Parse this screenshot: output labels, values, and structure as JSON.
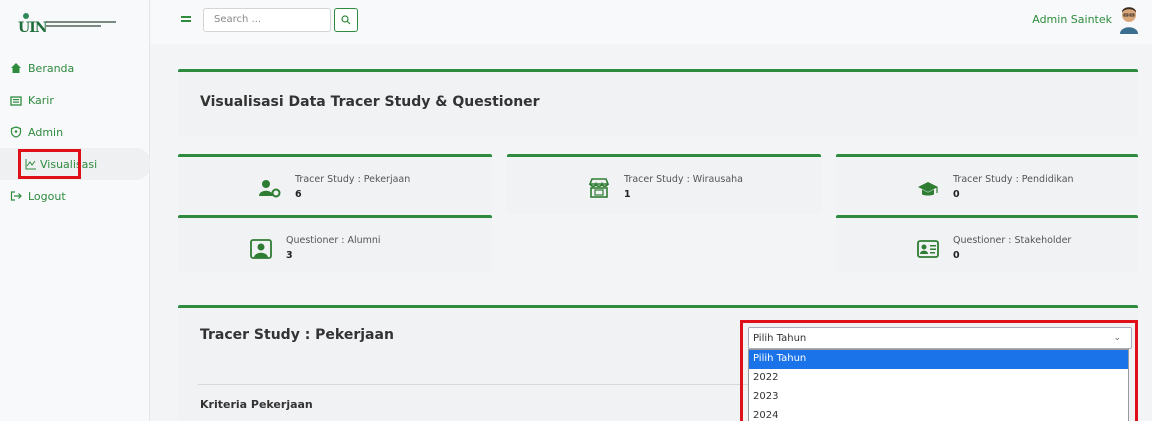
{
  "sidebar": {
    "items": [
      {
        "label": "Beranda",
        "icon": "home-icon"
      },
      {
        "label": "Karir",
        "icon": "briefcase-icon"
      },
      {
        "label": "Admin",
        "icon": "shield-icon"
      },
      {
        "label": "Visualisasi",
        "icon": "chart-icon",
        "active": true
      },
      {
        "label": "Logout",
        "icon": "logout-icon"
      }
    ]
  },
  "topbar": {
    "search_placeholder": "Search ...",
    "user_name": "Admin Saintek"
  },
  "main": {
    "page_title": "Visualisasi Data Tracer Study & Questioner",
    "stats": [
      {
        "label": "Tracer Study : Pekerjaan",
        "value": "6",
        "icon": "user-gear-icon"
      },
      {
        "label": "Tracer Study : Wirausaha",
        "value": "1",
        "icon": "store-icon"
      },
      {
        "label": "Tracer Study : Pendidikan",
        "value": "0",
        "icon": "graduation-cap-icon"
      },
      {
        "label": "Questioner : Alumni",
        "value": "3",
        "icon": "user-board-icon"
      },
      {
        "label": "Questioner : Stakeholder",
        "value": "0",
        "icon": "id-card-icon"
      }
    ],
    "section": {
      "title": "Tracer Study : Pekerjaan",
      "subheading": "Kriteria Pekerjaan",
      "year_select": {
        "selected": "Pilih Tahun",
        "options": [
          "Pilih Tahun",
          "2022",
          "2023",
          "2024"
        ]
      }
    }
  },
  "colors": {
    "accent": "#2e8b3e",
    "highlight": "#e0101a",
    "selected_option": "#1a73e8"
  }
}
